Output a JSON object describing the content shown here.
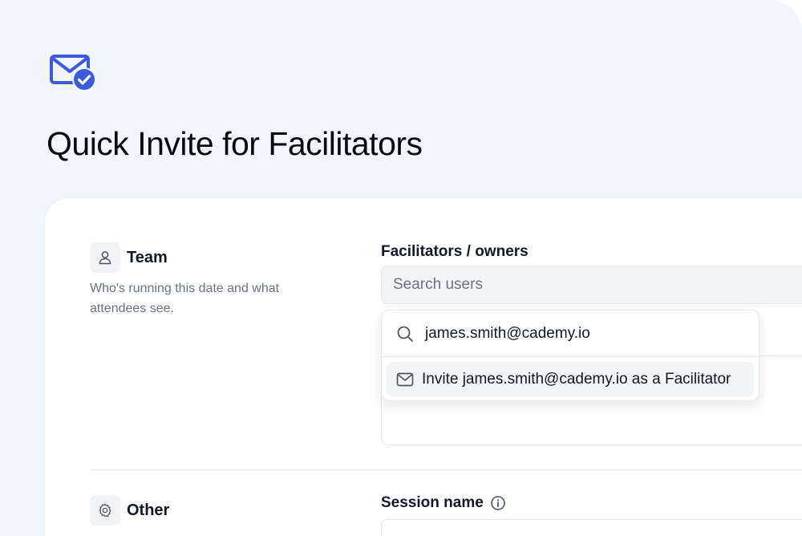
{
  "page": {
    "title": "Quick Invite for Facilitators",
    "hero_icon": "mail-check-icon",
    "accent_color": "#3b5bdb",
    "background_color": "#f1f5fe"
  },
  "team": {
    "title": "Team",
    "icon": "user-icon",
    "description": "Who's running this date and what attendees see."
  },
  "facilitators": {
    "label": "Facilitators / owners",
    "search_placeholder": "Search users",
    "dropdown": {
      "query": "james.smith@cademy.io",
      "option_label": "Invite james.smith@cademy.io as a Facilitator",
      "option_icon": "mail-icon"
    }
  },
  "other": {
    "title": "Other",
    "icon": "gear-icon"
  },
  "session": {
    "label": "Session name",
    "icon": "info-icon"
  }
}
